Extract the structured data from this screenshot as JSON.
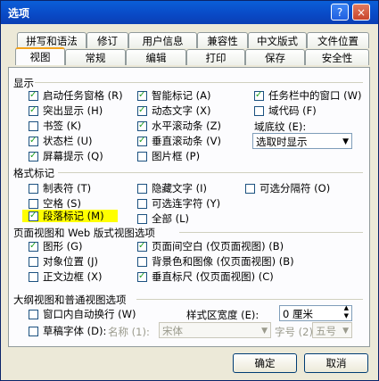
{
  "title": "选项",
  "title_help": "?",
  "title_close": "×",
  "tabs_top": [
    "拼写和语法",
    "修订",
    "用户信息",
    "兼容性",
    "中文版式",
    "文件位置"
  ],
  "tabs_bottom": [
    "视图",
    "常规",
    "编辑",
    "打印",
    "保存",
    "安全性"
  ],
  "display": {
    "title": "显示",
    "col1": [
      {
        "label": "启动任务窗格 (R)",
        "checked": true
      },
      {
        "label": "突出显示 (H)",
        "checked": true
      },
      {
        "label": "书签 (K)",
        "checked": false
      },
      {
        "label": "状态栏 (U)",
        "checked": true
      },
      {
        "label": "屏幕提示 (Q)",
        "checked": true
      }
    ],
    "col2": [
      {
        "label": "智能标记 (A)",
        "checked": true
      },
      {
        "label": "动态文字 (X)",
        "checked": true
      },
      {
        "label": "水平滚动条 (Z)",
        "checked": true
      },
      {
        "label": "垂直滚动条 (V)",
        "checked": true
      },
      {
        "label": "图片框 (P)",
        "checked": false
      }
    ],
    "col3": [
      {
        "label": "任务栏中的窗口 (W)",
        "checked": true
      },
      {
        "label": "域代码 (F)",
        "checked": false
      }
    ],
    "field_shading_label": "域底纹 (E):",
    "field_shading_value": "选取时显示"
  },
  "format_marks": {
    "title": "格式标记",
    "col1": [
      {
        "label": "制表符 (T)",
        "checked": false
      },
      {
        "label": "空格 (S)",
        "checked": false
      },
      {
        "label": "段落标记 (M)",
        "checked": true
      }
    ],
    "col2": [
      {
        "label": "隐藏文字 (I)",
        "checked": false
      },
      {
        "label": "可选连字符 (Y)",
        "checked": false
      },
      {
        "label": "全部 (L)",
        "checked": false
      }
    ],
    "col3": [
      {
        "label": "可选分隔符 (O)",
        "checked": false
      }
    ]
  },
  "print_web": {
    "title": "页面视图和 Web 版式视图选项",
    "col1": [
      {
        "label": "图形 (G)",
        "checked": true
      },
      {
        "label": "对象位置 (J)",
        "checked": false
      },
      {
        "label": "正文边框 (X)",
        "checked": false
      }
    ],
    "col2": [
      {
        "label": "页面间空白 (仅页面视图) (B)",
        "checked": true
      },
      {
        "label": "背景色和图像 (仅页面视图) (B)",
        "checked": false
      },
      {
        "label": "垂直标尺 (仅页面视图) (C)",
        "checked": true
      }
    ]
  },
  "outline": {
    "title": "大纲视图和普通视图选项",
    "wrap": {
      "label": "窗口内自动换行 (W)",
      "checked": false
    },
    "draft": {
      "label": "草稿字体 (D):",
      "checked": false
    },
    "style_width_label": "样式区宽度 (E):",
    "style_width_value": "0 厘米",
    "name_label": "名称 (1):",
    "name_value": "宋体",
    "size_label": "字号 (2):",
    "size_value": "五号"
  },
  "buttons": {
    "ok": "确定",
    "cancel": "取消"
  },
  "colors": {
    "accent": "#f3a31a",
    "title_bar": "#0949c6",
    "check": "#21a121"
  }
}
